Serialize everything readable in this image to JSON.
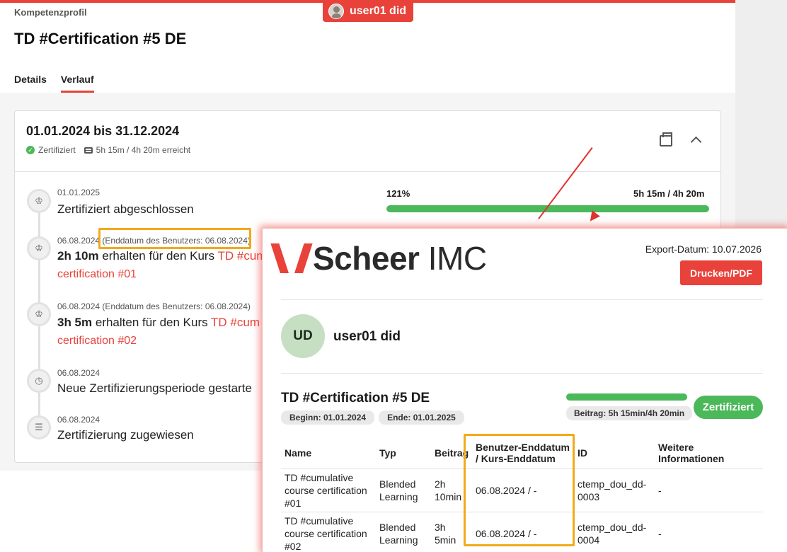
{
  "header": {
    "user_pill": "user01 did",
    "breadcrumb": "Kompetenzprofil",
    "title": "TD #Certification #5 DE"
  },
  "tabs": [
    {
      "label": "Details",
      "active": false
    },
    {
      "label": "Verlauf",
      "active": true
    }
  ],
  "period": {
    "title": "01.01.2024 bis 31.12.2024",
    "status": "Zertifiziert",
    "hours": "5h 15m / 4h 20m erreicht",
    "progress": {
      "percent_label": "121%",
      "hours_label": "5h 15m / 4h 20m",
      "fill_fraction": 1.0
    }
  },
  "timeline": [
    {
      "date": "01.01.2025",
      "title": "Zertifiziert abgeschlossen",
      "icon": "award-icon"
    },
    {
      "date": "06.08.2024",
      "date_note": "(Enddatum des Benutzers: 06.08.2024)",
      "title_bold": "2h 10m",
      "title_rest": " erhalten für den Kurs ",
      "link_part": "TD #cum",
      "link_line2": "certification #01",
      "icon": "award-icon"
    },
    {
      "date": "06.08.2024",
      "date_note": "(Enddatum des Benutzers: 06.08.2024)",
      "title_bold": "3h 5m",
      "title_rest": " erhalten für den Kurs ",
      "link_part": "TD #cum",
      "link_line2": "certification #02",
      "icon": "award-icon"
    },
    {
      "date": "06.08.2024",
      "title": "Neue Zertifizierungsperiode gestarte",
      "icon": "clock-icon"
    },
    {
      "date": "06.08.2024",
      "title": "Zertifizierung zugewiesen",
      "icon": "stack-icon"
    }
  ],
  "export": {
    "logo_bold": "Scheer",
    "logo_light": " IMC",
    "export_date": "Export-Datum: 10.07.2026",
    "print_button": "Drucken/PDF",
    "avatar_initials": "UD",
    "user_name": "user01 did",
    "cert_title": "TD #Certification #5 DE",
    "begin": "Beginn: 01.01.2024",
    "end": "Ende: 01.01.2025",
    "beitrag": "Beitrag: 5h 15min/4h 20min",
    "status_badge": "Zertifiziert",
    "table": {
      "headers": [
        "Name",
        "Typ",
        "Beitrag",
        "Benutzer-Enddatum / Kurs-Enddatum",
        "ID",
        "Weitere Informationen"
      ],
      "rows": [
        [
          "TD #cumulative course certification #01",
          "Blended Learning",
          "2h 10min",
          "06.08.2024 / -",
          "ctemp_dou_dd-0003",
          "-"
        ],
        [
          "TD #cumulative course certification #02",
          "Blended Learning",
          "3h 5min",
          "06.08.2024 / -",
          "ctemp_dou_dd-0004",
          "-"
        ]
      ]
    }
  },
  "colors": {
    "brand": "#e8423a",
    "success": "#4bb85a",
    "highlight": "#f2aa1a"
  }
}
